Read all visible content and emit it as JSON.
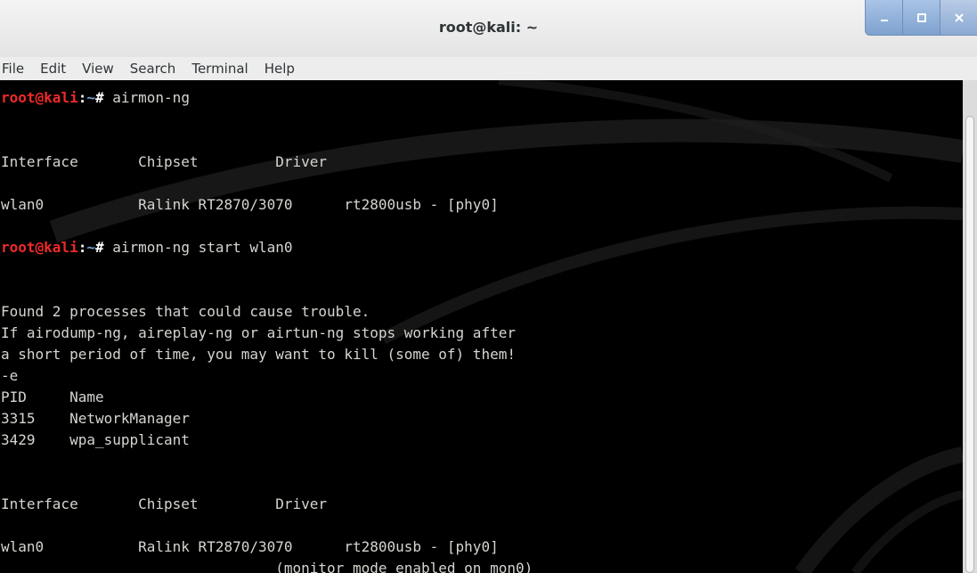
{
  "window": {
    "title": "root@kali: ~"
  },
  "window_controls": [
    {
      "icon": "minimize-icon"
    },
    {
      "icon": "maximize-icon"
    },
    {
      "icon": "close-icon"
    }
  ],
  "menu": [
    "File",
    "Edit",
    "View",
    "Search",
    "Terminal",
    "Help"
  ],
  "prompt": {
    "user": "root@kali",
    "sep": ":",
    "path": "~",
    "symbol": "# "
  },
  "terminal_lines": [
    {
      "prompt": true,
      "cmd": "airmon-ng"
    },
    {
      "text": ""
    },
    {
      "text": ""
    },
    {
      "text": "Interface\tChipset\t\tDriver"
    },
    {
      "text": ""
    },
    {
      "text": "wlan0\t\tRalink RT2870/3070\trt2800usb - [phy0]"
    },
    {
      "text": ""
    },
    {
      "prompt": true,
      "cmd": "airmon-ng start wlan0"
    },
    {
      "text": ""
    },
    {
      "text": ""
    },
    {
      "text": "Found 2 processes that could cause trouble."
    },
    {
      "text": "If airodump-ng, aireplay-ng or airtun-ng stops working after"
    },
    {
      "text": "a short period of time, you may want to kill (some of) them!"
    },
    {
      "text": "-e"
    },
    {
      "text": "PID\tName"
    },
    {
      "text": "3315\tNetworkManager"
    },
    {
      "text": "3429\twpa_supplicant"
    },
    {
      "text": ""
    },
    {
      "text": ""
    },
    {
      "text": "Interface\tChipset\t\tDriver"
    },
    {
      "text": ""
    },
    {
      "text": "wlan0\t\tRalink RT2870/3070\trt2800usb - [phy0]"
    },
    {
      "text": "\t\t\t\t(monitor mode enabled on mon0)"
    }
  ],
  "colors": {
    "prompt_user": "#ef2929",
    "prompt_path": "#729fcf",
    "output_text": "#d3d7cf",
    "background": "#000000"
  }
}
